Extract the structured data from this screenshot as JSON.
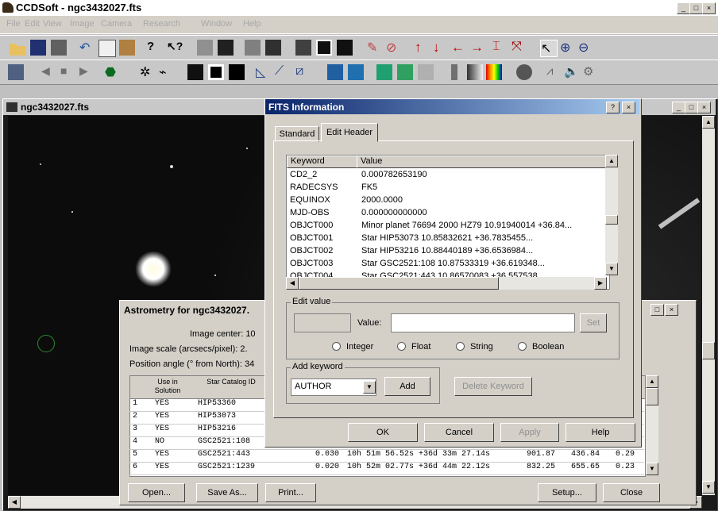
{
  "app": {
    "title": "CCDSoft - ngc3432027.fts",
    "min": "_",
    "max": "□",
    "close": "×"
  },
  "menu": [
    "File",
    "Edit",
    "View",
    "Image",
    "Camera",
    "Research",
    "Window",
    "Help"
  ],
  "image_window": {
    "title": "ngc3432027.fts"
  },
  "fits": {
    "title": "FITS Information",
    "help": "?",
    "close": "×",
    "tabs": [
      "Standard",
      "Edit Header"
    ],
    "col_keyword": "Keyword",
    "col_value": "Value",
    "rows": [
      {
        "k": "CD2_2",
        "v": "0.000782653190"
      },
      {
        "k": "RADECSYS",
        "v": "FK5"
      },
      {
        "k": "EQUINOX",
        "v": "2000.0000"
      },
      {
        "k": "MJD-OBS",
        "v": "0.000000000000"
      },
      {
        "k": "OBJCT000",
        "v": "Minor planet 76694 2000 HZ79 10.91940014 +36.84..."
      },
      {
        "k": "OBJCT001",
        "v": "Star        HIP53073      10.85832621 +36.7835455..."
      },
      {
        "k": "OBJCT002",
        "v": "Star        HIP53216      10.88440189 +36.6536984..."
      },
      {
        "k": "OBJCT003",
        "v": "Star        GSC2521:108      10.87533319 +36.619348..."
      },
      {
        "k": "OBJCT004",
        "v": "Star        GSC2521:443      10.86570083 +36.557538..."
      }
    ],
    "edit_value_label": "Edit value",
    "value_label": "Value:",
    "set_btn": "Set",
    "types": [
      "Integer",
      "Float",
      "String",
      "Boolean"
    ],
    "add_keyword_label": "Add keyword",
    "add_keyword_value": "AUTHOR",
    "add_btn": "Add",
    "delete_btn": "Delete Keyword",
    "ok": "OK",
    "cancel": "Cancel",
    "apply": "Apply",
    "help_btn": "Help"
  },
  "astrometry": {
    "title": "Astrometry for ngc3432027.",
    "image_center": "Image center:  10",
    "image_scale": "Image scale (arcsecs/pixel):  2.",
    "position_angle": "Position angle (° from North):  34",
    "col_use": "Use in Solution",
    "col_star": "Star Catalog ID",
    "rows": [
      {
        "n": "1",
        "use": "YES",
        "id": "HIP53360"
      },
      {
        "n": "2",
        "use": "YES",
        "id": "HIP53073"
      },
      {
        "n": "3",
        "use": "YES",
        "id": "HIP53216"
      },
      {
        "n": "4",
        "use": "NO",
        "id": "GSC2521:108"
      },
      {
        "n": "5",
        "use": "YES",
        "id": "GSC2521:443",
        "res": "0.030",
        "coord": "10h 51m 56.52s  +36d 33m 27.14s",
        "x": "901.87",
        "y": "436.84",
        "e": "0.29"
      },
      {
        "n": "6",
        "use": "YES",
        "id": "GSC2521:1239",
        "res": "0.020",
        "coord": "10h 52m 02.77s  +36d 44m 22.12s",
        "x": "832.25",
        "y": "655.65",
        "e": "0.23"
      }
    ],
    "buttons": [
      "Open...",
      "Save As...",
      "Print...",
      "Setup...",
      "Close"
    ]
  }
}
